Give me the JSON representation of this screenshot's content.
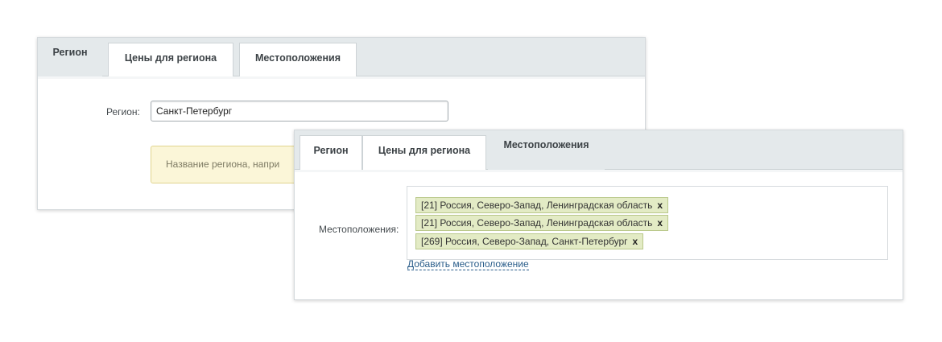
{
  "back_panel": {
    "tabs": [
      {
        "label": "Регион",
        "active": true
      },
      {
        "label": "Цены для региона",
        "active": false
      },
      {
        "label": "Местоположения",
        "active": false
      }
    ],
    "region_label": "Регион:",
    "region_value": "Санкт-Петербург",
    "hint_text": "Название региона, напри"
  },
  "front_panel": {
    "tabs": [
      {
        "label": "Регион",
        "active": false
      },
      {
        "label": "Цены для региона",
        "active": false
      },
      {
        "label": "Местоположения",
        "active": true
      }
    ],
    "locations_label": "Местоположения:",
    "locations": [
      {
        "text": "[21] Россия, Северо-Запад, Ленинградская область",
        "remove": "x"
      },
      {
        "text": "[21] Россия, Северо-Запад, Ленинградская область",
        "remove": "x"
      },
      {
        "text": "[269] Россия, Северо-Запад, Санкт-Петербург",
        "remove": "x"
      }
    ],
    "add_location_label": "Добавить местоположение"
  }
}
